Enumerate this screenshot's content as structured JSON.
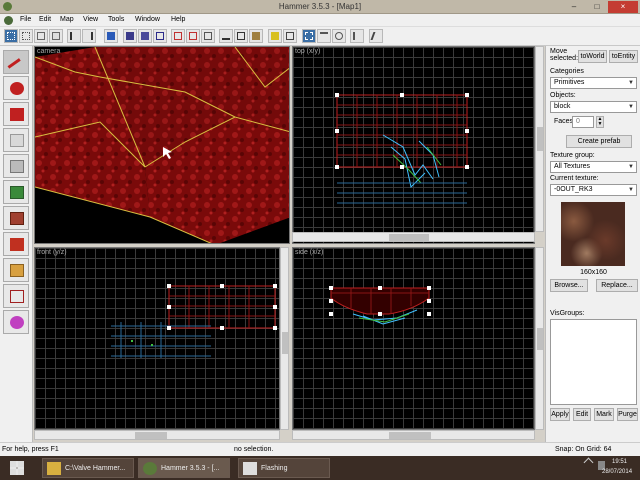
{
  "window": {
    "title": "Hammer 3.5.3 - [Map1]",
    "minimize": "–",
    "maximize": "□",
    "close": "×"
  },
  "menu": [
    "File",
    "Edit",
    "Map",
    "View",
    "Tools",
    "Window",
    "Help"
  ],
  "viewports": {
    "camera": "camera",
    "top": "top (x/y)",
    "front": "front (y/z)",
    "side": "side (x/z)"
  },
  "right_panel": {
    "move_selected": "Move selected:",
    "to_world": "toWorld",
    "to_entity": "toEntity",
    "categories_label": "Categories",
    "categories_value": "Primitives",
    "objects_label": "Objects:",
    "objects_value": "block",
    "faces_label": "Faces:",
    "faces_value": "0",
    "create_prefab": "Create prefab",
    "texture_group_label": "Texture group:",
    "texture_group_value": "All Textures",
    "current_texture_label": "Current texture:",
    "current_texture_value": "-0OUT_RK3",
    "texture_size": "160x160",
    "browse": "Browse...",
    "replace": "Replace...",
    "visgroups_label": "VisGroups:",
    "apply": "Apply",
    "edit": "Edit",
    "mark": "Mark",
    "purge": "Purge"
  },
  "status": {
    "help": "For help, press F1",
    "selection": "no selection.",
    "snap": "Snap: On Grid: 64"
  },
  "taskbar": {
    "items": [
      "C:\\Valve Hammer...",
      "Hammer 3.5.3 - [...",
      "Flashing"
    ],
    "time": "19:51",
    "date": "28/07/2014"
  },
  "colors": {
    "brush": "#c02020",
    "selection": "#ffffff",
    "grid": "#3a3a3a",
    "wire": "#40c0ff"
  }
}
